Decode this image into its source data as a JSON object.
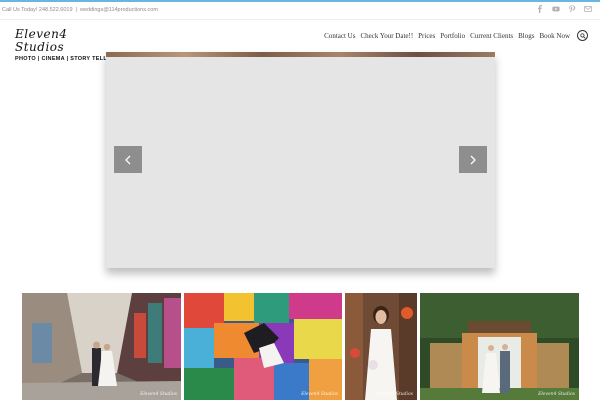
{
  "topbar": {
    "call_text": "Call Us Today! 248.522.6019",
    "separator": "|",
    "email": "weddings@114productions.com",
    "social_icons": [
      "facebook-icon",
      "youtube-icon",
      "pinterest-icon",
      "email-icon"
    ]
  },
  "logo": {
    "name": "Eleven4 Studios",
    "tagline": "PHOTO | CINEMA | STORY TELLING"
  },
  "nav": {
    "items": [
      "Contact Us",
      "Check Your Date!!",
      "Prices",
      "Portfolio",
      "Current Clients",
      "Blogs",
      "Book Now"
    ]
  },
  "slider": {
    "prev_icon": "chevron-left-icon",
    "next_icon": "chevron-right-icon"
  },
  "gallery": {
    "watermark": "Eleven4 Studios"
  },
  "colors": {
    "accent": "#67b7e1",
    "slider_bg": "#e5e5e5",
    "arrow_bg": "#8e8e8e"
  }
}
